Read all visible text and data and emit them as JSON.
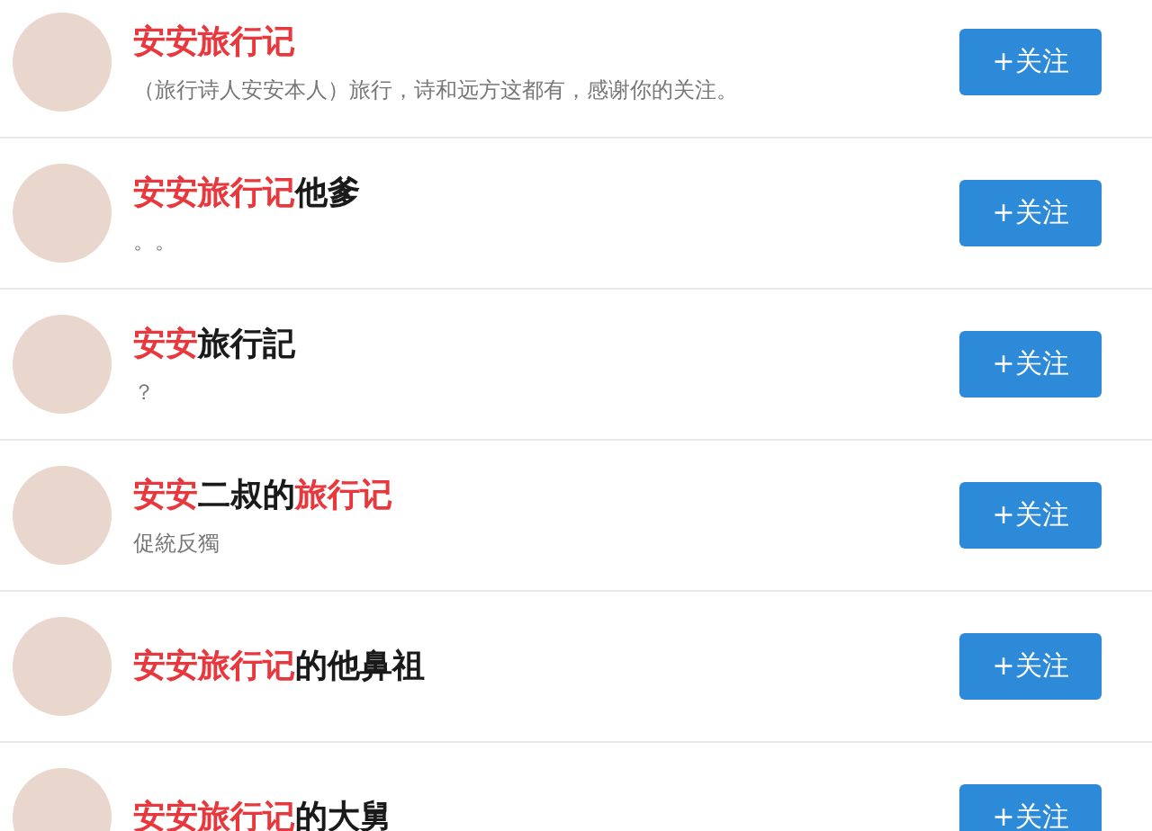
{
  "users": [
    {
      "name": [
        {
          "text": "安安旅行记",
          "highlight": true
        }
      ],
      "bio": "（旅行诗人安安本人）旅行，诗和远方这都有，感谢你的关注。",
      "button": "+关注"
    },
    {
      "name": [
        {
          "text": "安安旅行记",
          "highlight": true
        },
        {
          "text": "他爹",
          "highlight": false
        }
      ],
      "bio": "。。",
      "button": "+关注"
    },
    {
      "name": [
        {
          "text": "安安",
          "highlight": true
        },
        {
          "text": "旅行記",
          "highlight": false
        }
      ],
      "bio": "？",
      "button": "+关注"
    },
    {
      "name": [
        {
          "text": "安安",
          "highlight": true
        },
        {
          "text": "二叔的",
          "highlight": false
        },
        {
          "text": "旅行记",
          "highlight": true
        }
      ],
      "bio": "促統反獨",
      "button": "+关注"
    },
    {
      "name": [
        {
          "text": "安安旅行记",
          "highlight": true
        },
        {
          "text": "的他鼻祖",
          "highlight": false
        }
      ],
      "button": "+关注"
    },
    {
      "name": [
        {
          "text": "安安旅行记",
          "highlight": true
        },
        {
          "text": "的大舅",
          "highlight": false
        }
      ],
      "button": "+关注"
    }
  ]
}
